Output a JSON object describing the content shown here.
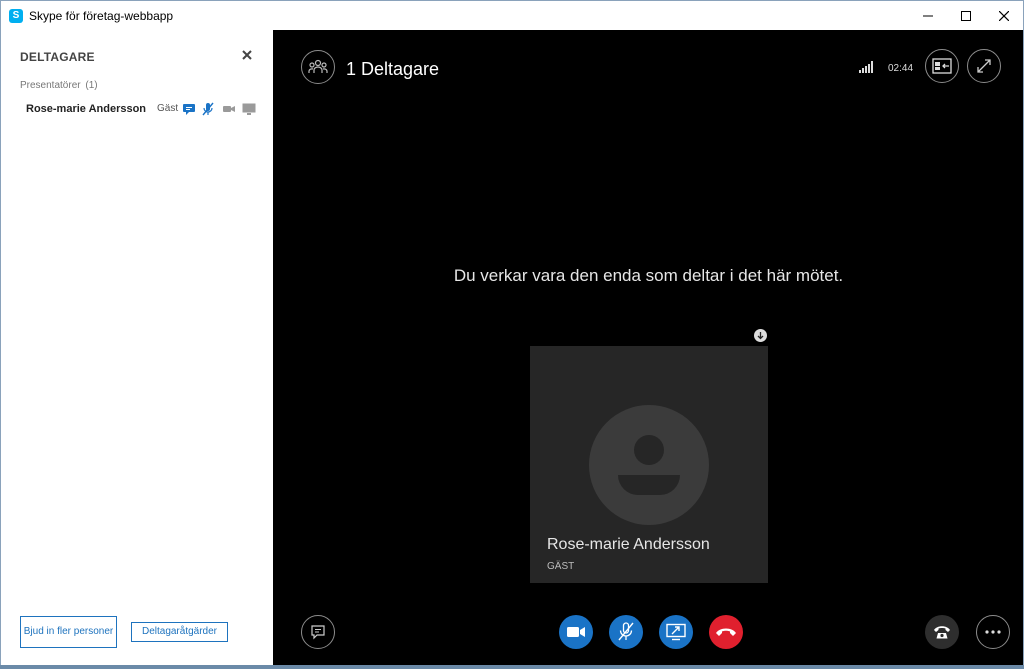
{
  "window": {
    "title": "Skype för företag-webbapp",
    "app_icon_letter": "S",
    "minimize": "—",
    "maximize": "☐",
    "close": "✕"
  },
  "participants_pane": {
    "title": "DELTAGARE",
    "close_glyph": "✕",
    "group_label": "Presentatörer",
    "group_count": "(1)",
    "participants": [
      {
        "name": "Rose-marie Andersson",
        "role": "Gäst"
      }
    ],
    "invite_button": "Bjud in fler personer",
    "actions_button": "Deltagaråtgärder"
  },
  "meeting": {
    "participant_count_label": "1 Deltagare",
    "timer": "02:44",
    "alone_message": "Du verkar vara den enda som deltar i det här mötet.",
    "self_tile": {
      "name": "Rose-marie Andersson",
      "role": "GÄST"
    }
  },
  "colors": {
    "accent_blue": "#1a73c6",
    "hangup_red": "#e0202e",
    "link_blue": "#1e73be",
    "stage_bg": "#000000"
  },
  "icons": {
    "participants": "people-icon",
    "signal": "signal-strength-icon",
    "layout": "layout-icon",
    "fullscreen": "fullscreen-icon",
    "chat": "chat-icon",
    "video": "video-camera-icon",
    "mic": "mic-muted-icon",
    "share": "share-screen-icon",
    "hangup": "hangup-icon",
    "callcontrols": "phone-icon",
    "more": "more-options-icon"
  }
}
